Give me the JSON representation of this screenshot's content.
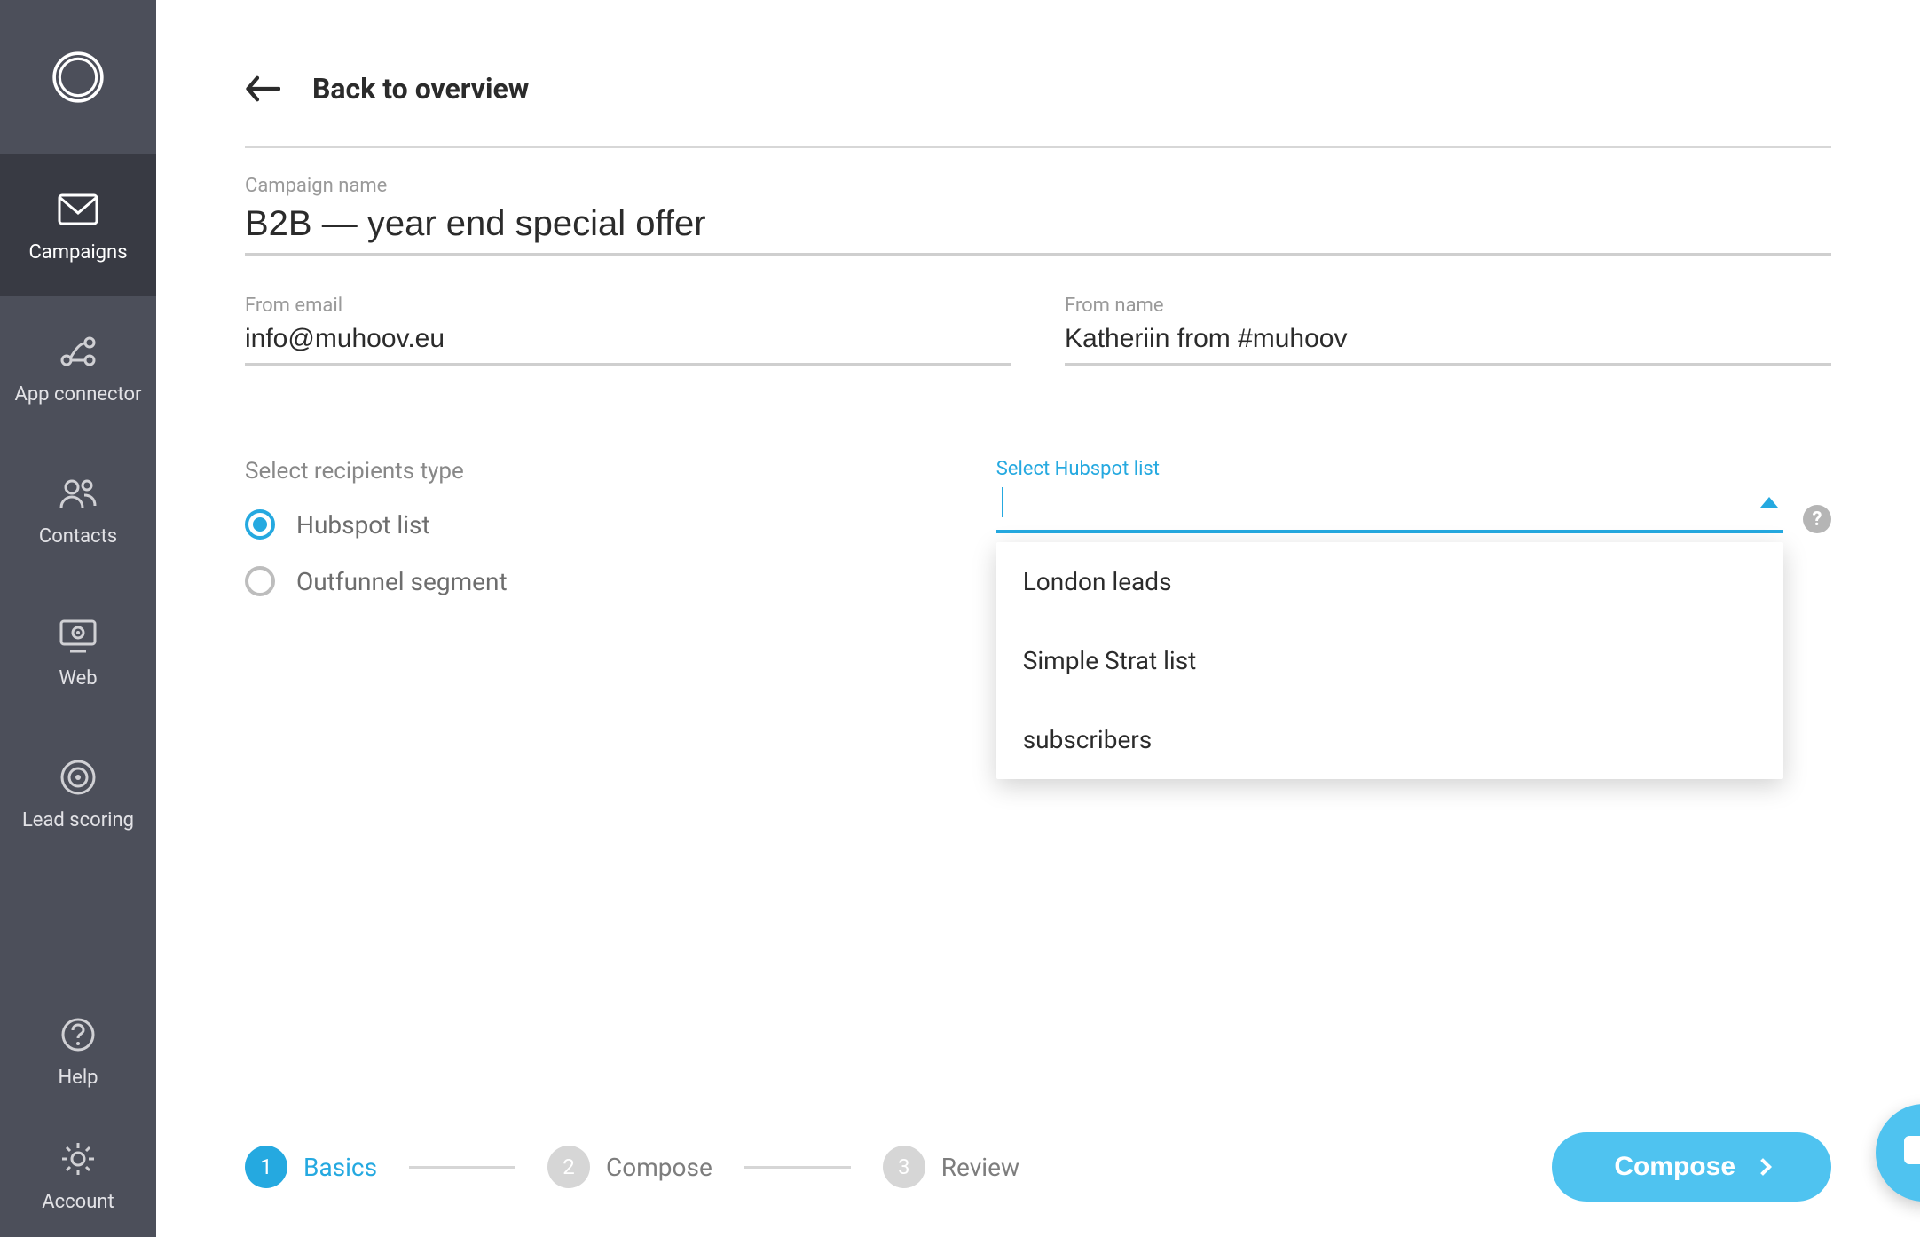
{
  "sidebar": {
    "items": [
      {
        "label": "Campaigns"
      },
      {
        "label": "App connector"
      },
      {
        "label": "Contacts"
      },
      {
        "label": "Web"
      },
      {
        "label": "Lead scoring"
      }
    ],
    "bottom": [
      {
        "label": "Help"
      },
      {
        "label": "Account"
      }
    ]
  },
  "header": {
    "back_label": "Back to overview"
  },
  "fields": {
    "campaign_name_label": "Campaign name",
    "campaign_name": "B2B — year end special offer",
    "from_email_label": "From email",
    "from_email": "info@muhoov.eu",
    "from_name_label": "From name",
    "from_name": "Katheriin from #muhoov"
  },
  "recipients": {
    "section_label": "Select recipients type",
    "options": [
      {
        "label": "Hubspot list",
        "selected": true
      },
      {
        "label": "Outfunnel segment",
        "selected": false
      }
    ]
  },
  "hubspot_select": {
    "label": "Select Hubspot list",
    "value": "",
    "options": [
      "London leads",
      "Simple Strat list",
      "subscribers"
    ],
    "help_char": "?"
  },
  "stepper": {
    "steps": [
      {
        "num": "1",
        "label": "Basics",
        "active": true
      },
      {
        "num": "2",
        "label": "Compose",
        "active": false
      },
      {
        "num": "3",
        "label": "Review",
        "active": false
      }
    ],
    "compose_button": "Compose"
  },
  "colors": {
    "accent": "#25A9E0",
    "sidebar_bg": "#4c4f5a",
    "sidebar_active": "#383a43",
    "button_bg": "#4FC3F0"
  }
}
